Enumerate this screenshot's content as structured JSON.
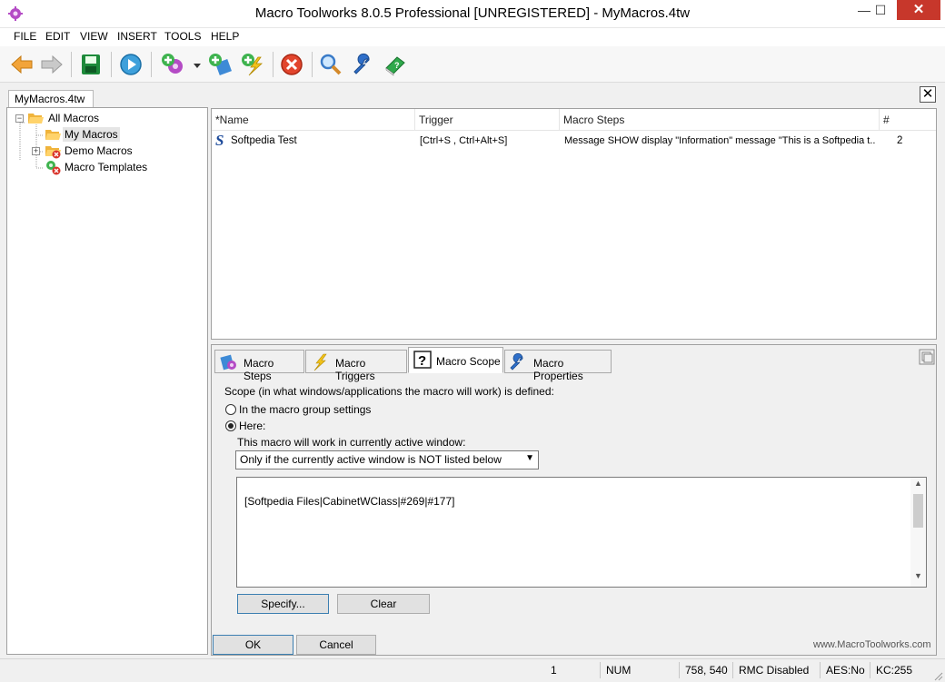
{
  "window": {
    "title": "Macro Toolworks 8.0.5 Professional [UNREGISTERED] - MyMacros.4tw",
    "minimize": "—",
    "maximize": "☐",
    "close": "✕"
  },
  "menu": [
    "FILE",
    "EDIT",
    "VIEW",
    "INSERT",
    "TOOLS",
    "HELP"
  ],
  "toolbar": {
    "icons": [
      "back-arrow-icon",
      "forward-arrow-icon",
      "save-icon",
      "play-icon",
      "new-macro-icon",
      "new-macro-dropdown",
      "new-step-icon",
      "new-trigger-icon",
      "delete-icon",
      "find-icon",
      "settings-wrench-icon",
      "help-book-icon"
    ]
  },
  "document_tab": {
    "label": "MyMacros.4tw",
    "close": "✕"
  },
  "tree": {
    "items": [
      {
        "label": "All Macros",
        "icon": "folder-open-icon"
      },
      {
        "label": "My Macros",
        "icon": "folder-open-icon",
        "selected": true
      },
      {
        "label": "Demo Macros",
        "icon": "folder-disabled-icon"
      },
      {
        "label": "Macro Templates",
        "icon": "template-disabled-icon"
      }
    ]
  },
  "macro_list": {
    "columns": [
      "*Name",
      "Trigger",
      "Macro Steps",
      "#"
    ],
    "rows": [
      {
        "name": "Softpedia Test",
        "trigger": "[Ctrl+S , Ctrl+Alt+S]",
        "steps": "Message SHOW display \"Information\" message \"This is a Softpedia t...",
        "count": "2"
      }
    ]
  },
  "detail_tabs": [
    {
      "label": "Macro Steps",
      "icon": "macro-steps-icon"
    },
    {
      "label": "Macro Triggers",
      "icon": "lightning-icon"
    },
    {
      "label": "Macro Scope",
      "icon": "question-icon",
      "active": true
    },
    {
      "label": "Macro Properties",
      "icon": "wrench-icon"
    }
  ],
  "scope": {
    "intro": "Scope (in what windows/applications the macro will work) is defined:",
    "option_group": "In the macro group settings",
    "option_here": "Here:",
    "work_label": "This macro will work in currently active window:",
    "mode_selected": "Only if the currently active window is NOT listed below",
    "window_list": "[Softpedia Files|CabinetWClass|#269|#177]",
    "specify_button": "Specify...",
    "clear_button": "Clear"
  },
  "buttons": {
    "ok": "OK",
    "cancel": "Cancel"
  },
  "website": "www.MacroToolworks.com",
  "statusbar": {
    "count": "1",
    "num": "NUM",
    "coords": "758, 540",
    "rmc": "RMC Disabled",
    "aes": "AES:No",
    "kc": "KC:255"
  }
}
